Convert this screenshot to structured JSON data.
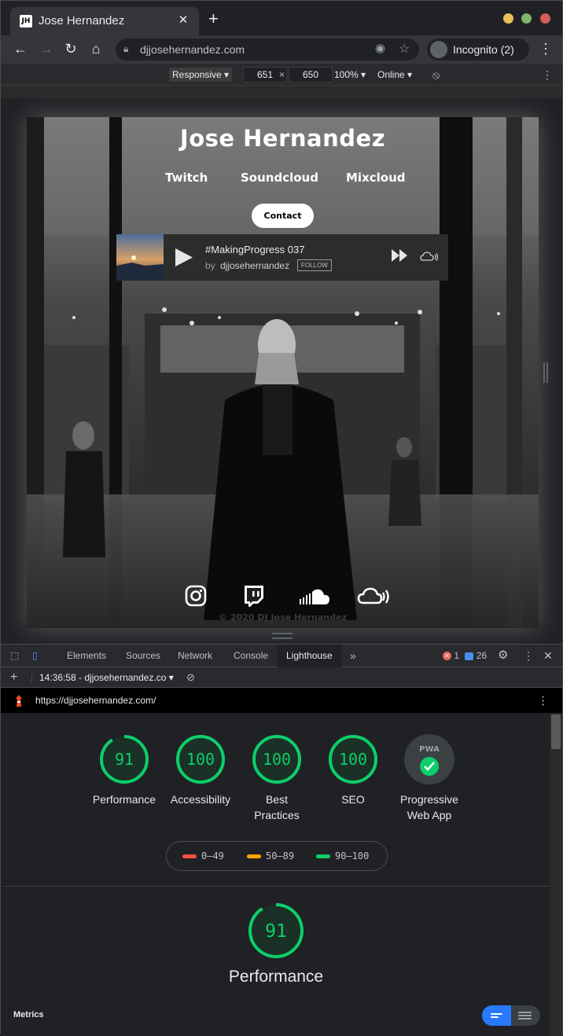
{
  "browser": {
    "tab_title": "Jose Hernandez",
    "tab_favicon": "JH",
    "url": "djjosehernandez.com",
    "incognito_label": "Incognito (2)",
    "window_dots": [
      "#e8c15a",
      "#7fb46b",
      "#d45c5c"
    ]
  },
  "device_toolbar": {
    "mode": "Responsive",
    "width": "651",
    "height": "650",
    "zoom": "100%",
    "network": "Online"
  },
  "site": {
    "title": "Jose Hernandez",
    "nav": [
      "Twitch",
      "Soundcloud",
      "Mixcloud"
    ],
    "contact": "Contact",
    "player": {
      "track": "#MakingProgress 037",
      "by": "by",
      "artist": "djjosehernandez",
      "follow": "FOLLOW"
    },
    "social_icons": [
      "instagram-icon",
      "twitch-icon",
      "soundcloud-icon",
      "mixcloud-icon"
    ],
    "copyright": "© 2020 DJ Jose Hernandez"
  },
  "devtools": {
    "tabs": [
      "Elements",
      "Sources",
      "Network",
      "Console",
      "Lighthouse"
    ],
    "active_tab": "Lighthouse",
    "error_count": "1",
    "message_count": "26",
    "report_time": "14:36:58 - djjosehernandez.co",
    "report_url": "https://djjosehernandez.com/"
  },
  "lighthouse": {
    "scores": [
      {
        "label": "Performance",
        "value": 91
      },
      {
        "label": "Accessibility",
        "value": 100
      },
      {
        "label": "Best Practices",
        "value": 100
      },
      {
        "label": "SEO",
        "value": 100
      }
    ],
    "pwa_label": "Progressive Web App",
    "pwa_badge": "PWA",
    "legend": [
      {
        "range": "0–49",
        "color": "#ff4e42"
      },
      {
        "range": "50–89",
        "color": "#ffa400"
      },
      {
        "range": "90–100",
        "color": "#0cce6b"
      }
    ],
    "main_score": "91",
    "main_label": "Performance",
    "metrics_label": "Metrics",
    "pass_color": "#0cce6b"
  }
}
